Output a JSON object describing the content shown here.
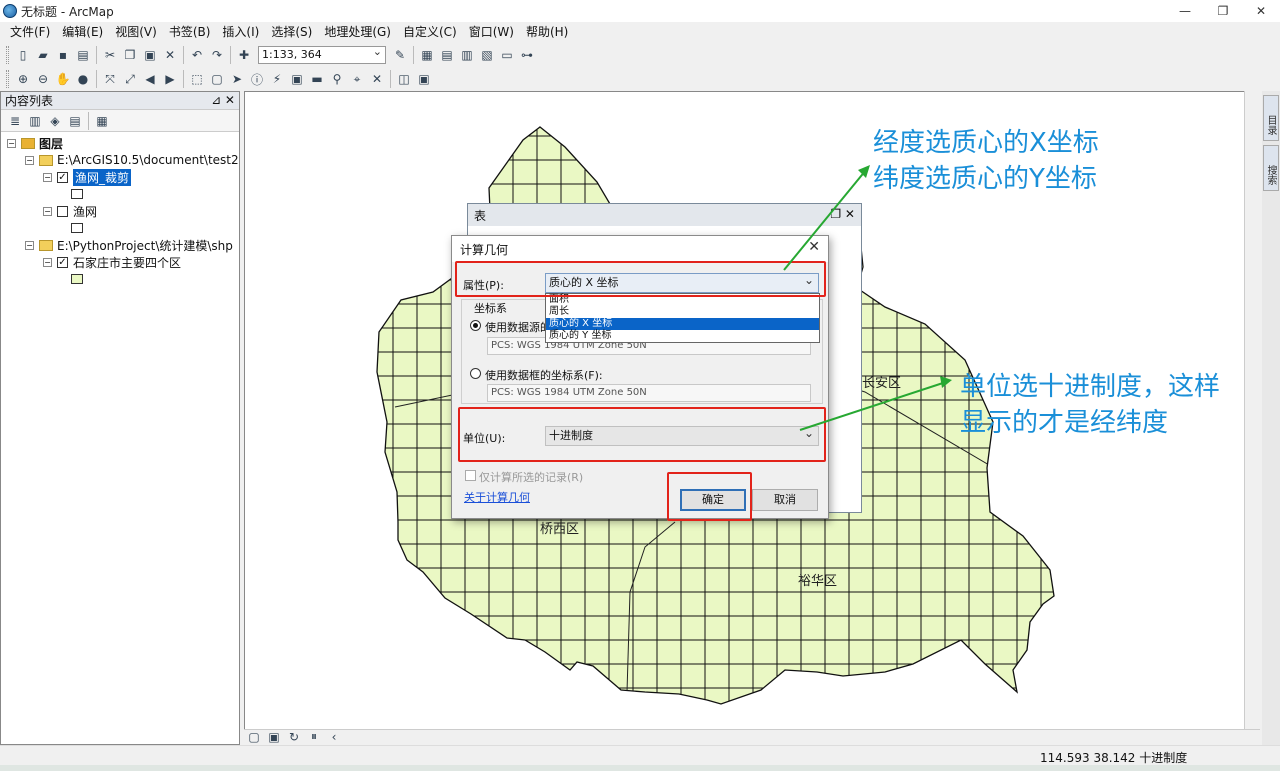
{
  "window": {
    "title": "无标题 - ArcMap",
    "minimize": "—",
    "restore": "❐",
    "close": "✕"
  },
  "menu": [
    "文件(F)",
    "编辑(E)",
    "视图(V)",
    "书签(B)",
    "插入(I)",
    "选择(S)",
    "地理处理(G)",
    "自定义(C)",
    "窗口(W)",
    "帮助(H)"
  ],
  "toolbar": {
    "scale": "1:133, 364"
  },
  "toc": {
    "title": "内容列表",
    "pin": "⊿ ✕",
    "root": "图层",
    "folder1": "E:\\ArcGIS10.5\\document\\test2",
    "layer1": "渔网_裁剪",
    "layer2": "渔网",
    "folder2": "E:\\PythonProject\\统计建模\\shp",
    "layer3": "石家庄市主要四个区"
  },
  "dock": {
    "tab1": "目录",
    "tab2": "搜索"
  },
  "table_window": {
    "title": "表"
  },
  "dialog": {
    "title": "计算几何",
    "property_label": "属性(P):",
    "property_value": "质心的 X 坐标",
    "options": [
      "面积",
      "周长",
      "质心的 X 坐标",
      "质心的 Y 坐标"
    ],
    "selected_option": "质心的 X 坐标",
    "coord_group": "坐标系",
    "use_source": "使用数据源的坐标系(D):",
    "source_pcs": "PCS: WGS 1984 UTM Zone 50N",
    "use_frame": "使用数据框的坐标系(F):",
    "frame_pcs": "PCS: WGS 1984 UTM Zone 50N",
    "units_label": "单位(U):",
    "units_value": "十进制度",
    "selected_only": "仅计算所选的记录(R)",
    "help_link": "关于计算几何",
    "ok": "确定",
    "cancel": "取消"
  },
  "annotations": {
    "top_line1": "经度选质心的X坐标",
    "top_line2": "纬度选质心的Y坐标",
    "mid_line1": "单位选十进制度，这样",
    "mid_line2": "显示的才是经纬度"
  },
  "map_labels": {
    "changan": "长安区",
    "qiaoxi": "桥西区",
    "yuhua": "裕华区"
  },
  "status": {
    "coordinates": "114.593  38.142 十进制度"
  },
  "colors": {
    "fill": "#eaf8c4",
    "accent_red": "#e2231a",
    "annotation": "#1a8fd8",
    "arrow": "#27a832"
  }
}
